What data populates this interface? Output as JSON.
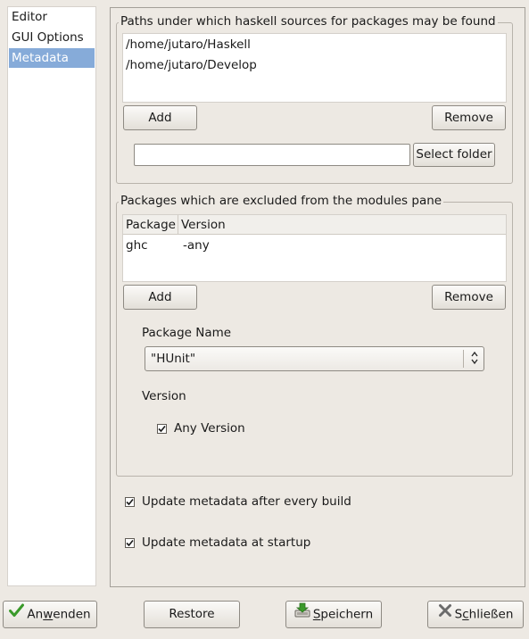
{
  "sidebar": {
    "items": [
      {
        "label": "Editor",
        "selected": false
      },
      {
        "label": "GUI Options",
        "selected": false
      },
      {
        "label": "Metadata",
        "selected": true
      }
    ],
    "selected_color": "#86abd9"
  },
  "paths_frame": {
    "title": "Paths under which haskell sources for packages may be found",
    "paths": [
      "/home/jutaro/Haskell",
      "/home/jutaro/Develop"
    ],
    "add_label": "Add",
    "remove_label": "Remove",
    "folder_entry_value": "",
    "select_folder_label": "Select folder"
  },
  "excluded_frame": {
    "title": "Packages which are excluded from the modules pane",
    "columns": [
      "Package",
      "Version"
    ],
    "rows": [
      {
        "package": "ghc",
        "version": "-any"
      }
    ],
    "add_label": "Add",
    "remove_label": "Remove",
    "package_name_label": "Package Name",
    "package_name_value": "\"HUnit\"",
    "version_label": "Version",
    "any_version_label": "Any Version",
    "any_version_checked": true
  },
  "options": {
    "update_after_build_label": "Update metadata after every build",
    "update_after_build_checked": true,
    "update_at_startup_label": "Update metadata at startup",
    "update_at_startup_checked": true
  },
  "footer": {
    "apply_label_pre": "An",
    "apply_label_mnemonic": "w",
    "apply_label_post": "enden",
    "restore_label": "Restore",
    "save_label_mnemonic": "S",
    "save_label_post": "peichern",
    "close_label_pre": "S",
    "close_label_mnemonic": "c",
    "close_label_post": "hließen",
    "icons": [
      "check-icon",
      "save-icon",
      "close-icon"
    ]
  },
  "colors": {
    "background": "#ede9e3",
    "accent": "#86abd9",
    "check_green": "#3a9a2a",
    "close_gray": "#6b6b6b"
  }
}
